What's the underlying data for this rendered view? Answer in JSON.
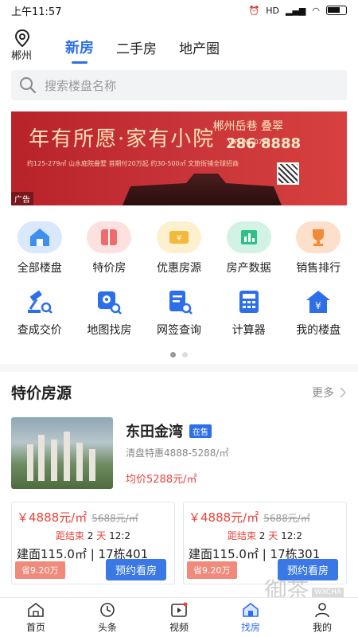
{
  "statusbar": {
    "time": "上午11:57",
    "signal": "HD"
  },
  "city": {
    "name": "郴州"
  },
  "tabs": [
    {
      "label": "新房",
      "active": true
    },
    {
      "label": "二手房",
      "active": false
    },
    {
      "label": "地产圈",
      "active": false
    }
  ],
  "search": {
    "placeholder": "搜索楼盘名称"
  },
  "banner": {
    "slogan": "年有所愿·家有小院",
    "sub": "约125-279㎡ 山水庭院叠墅  首期付20万起  约30-500㎡ 文旅街铺全球招商",
    "brand": "郴州岳巷 叠翠",
    "phone_label": "VIPLINE 0735",
    "phone": "286 8888",
    "ad_tag": "广告"
  },
  "grid": [
    {
      "label": "全部楼盘",
      "icon": "home-icon",
      "color": "#3d8ff0"
    },
    {
      "label": "特价房",
      "icon": "book-icon",
      "color": "#f06b6b"
    },
    {
      "label": "优惠房源",
      "icon": "ticket-icon",
      "color": "#f2b93a"
    },
    {
      "label": "房产数据",
      "icon": "bar-chart-icon",
      "color": "#2fbf8a"
    },
    {
      "label": "销售排行",
      "icon": "trophy-icon",
      "color": "#f38a3a"
    },
    {
      "label": "查成交价",
      "icon": "gavel-search-icon",
      "color": "#2d6fe8"
    },
    {
      "label": "地图找房",
      "icon": "map-search-icon",
      "color": "#2d6fe8"
    },
    {
      "label": "网签查询",
      "icon": "document-search-icon",
      "color": "#2d6fe8"
    },
    {
      "label": "计算器",
      "icon": "calculator-icon",
      "color": "#2d6fe8"
    },
    {
      "label": "我的楼盘",
      "icon": "my-house-icon",
      "color": "#2d6fe8"
    }
  ],
  "pager": {
    "pages": 2,
    "active": 0
  },
  "special": {
    "title": "特价房源",
    "more": "更多",
    "listing": {
      "name": "东田金湾",
      "badge": "在售",
      "promo": "清盘特惠4888-5288/㎡",
      "avg_price": "均价5288元/㎡"
    },
    "cards": [
      {
        "price": "￥4888元/㎡",
        "orig": "5688元/㎡",
        "countdown_label": "距结束",
        "days": "2",
        "day_unit": "天",
        "time": "12:2",
        "spec": "建面115.0㎡ | 17栋401",
        "save": "省9.20万",
        "book": "预约看房"
      },
      {
        "price": "￥4888元/㎡",
        "orig": "5688元/㎡",
        "countdown_label": "距结束",
        "days": "2",
        "day_unit": "天",
        "time": "12:2",
        "spec": "建面115.0㎡ | 17栋301",
        "save": "省9.20万",
        "book": "预约看房"
      }
    ]
  },
  "watermark": {
    "text": "御茶",
    "small": "WXCHA"
  },
  "bottom_nav": [
    {
      "label": "首页",
      "icon": "home-outline-icon",
      "active": false
    },
    {
      "label": "头条",
      "icon": "headline-icon",
      "active": false
    },
    {
      "label": "视频",
      "icon": "video-icon",
      "active": false
    },
    {
      "label": "找房",
      "icon": "find-house-icon",
      "active": true
    },
    {
      "label": "我的",
      "icon": "user-icon",
      "active": false
    }
  ]
}
